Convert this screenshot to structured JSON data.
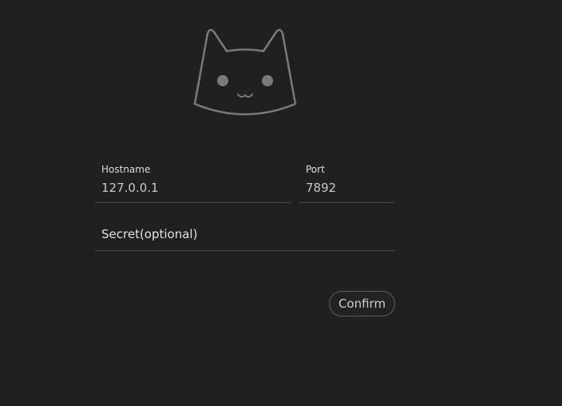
{
  "logo": {
    "icon": "cat-face-icon"
  },
  "form": {
    "hostname": {
      "label": "Hostname",
      "value": "127.0.0.1"
    },
    "port": {
      "label": "Port",
      "value": "7892"
    },
    "secret": {
      "placeholder": "Secret(optional)"
    },
    "confirm_label": "Confirm"
  },
  "colors": {
    "background": "#202020",
    "logo_stroke": "#7a7a7a",
    "underline": "#4a4a4a",
    "button_border": "#5c5c5c"
  }
}
